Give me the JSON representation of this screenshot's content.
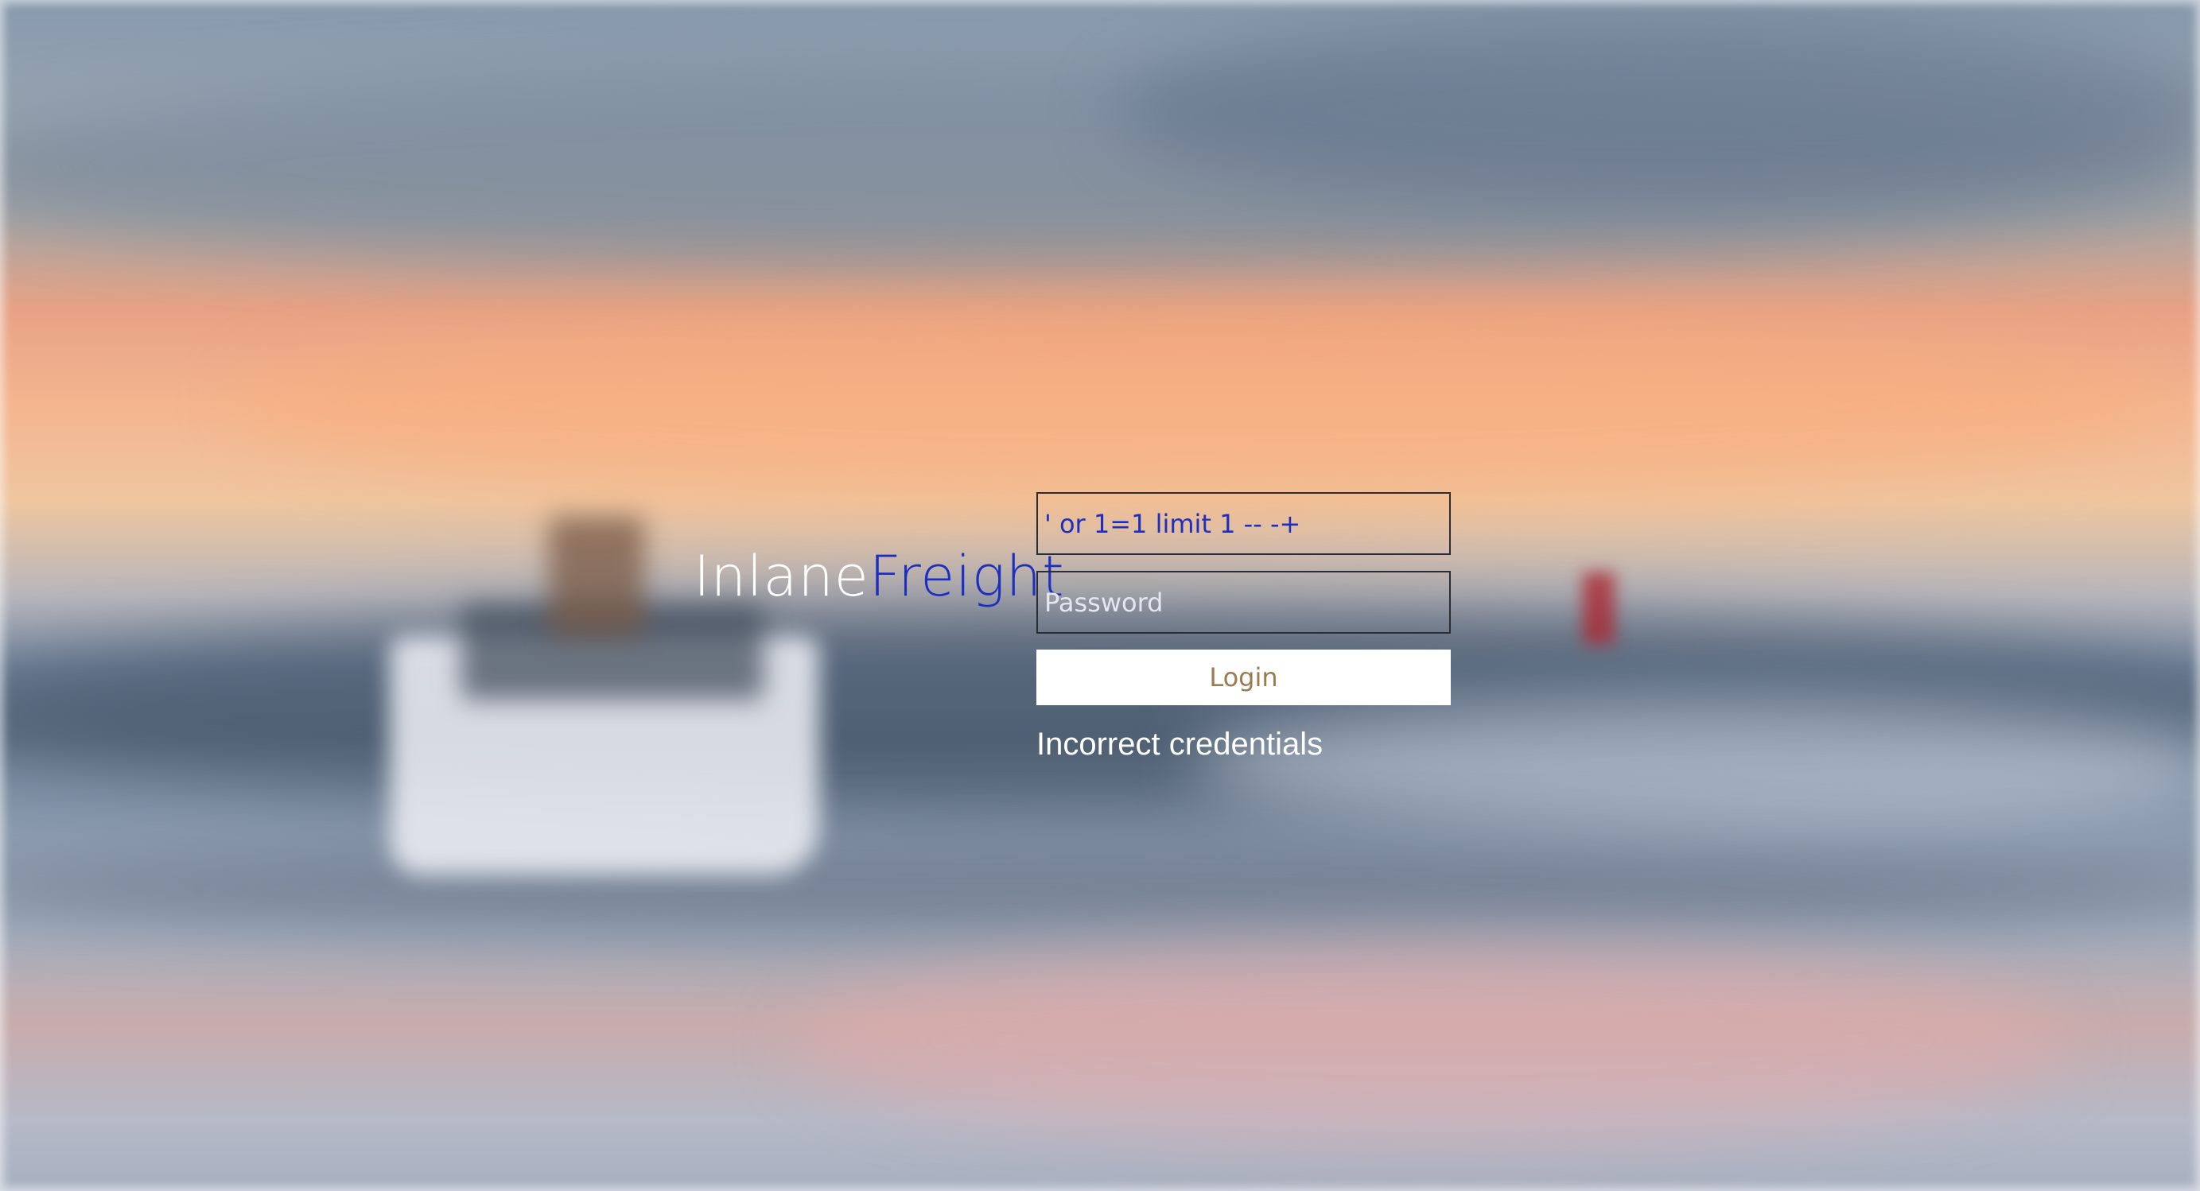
{
  "brand": {
    "part_1": "Inlane",
    "part_2": "Freight"
  },
  "login_form": {
    "username_value": "' or 1=1 limit 1 -- -+",
    "password_placeholder": "Password",
    "login_label": "Login",
    "error_message": "Incorrect credentials"
  },
  "colors": {
    "brand_accent": "#1d2fbf",
    "button_text": "#9a7b52"
  }
}
